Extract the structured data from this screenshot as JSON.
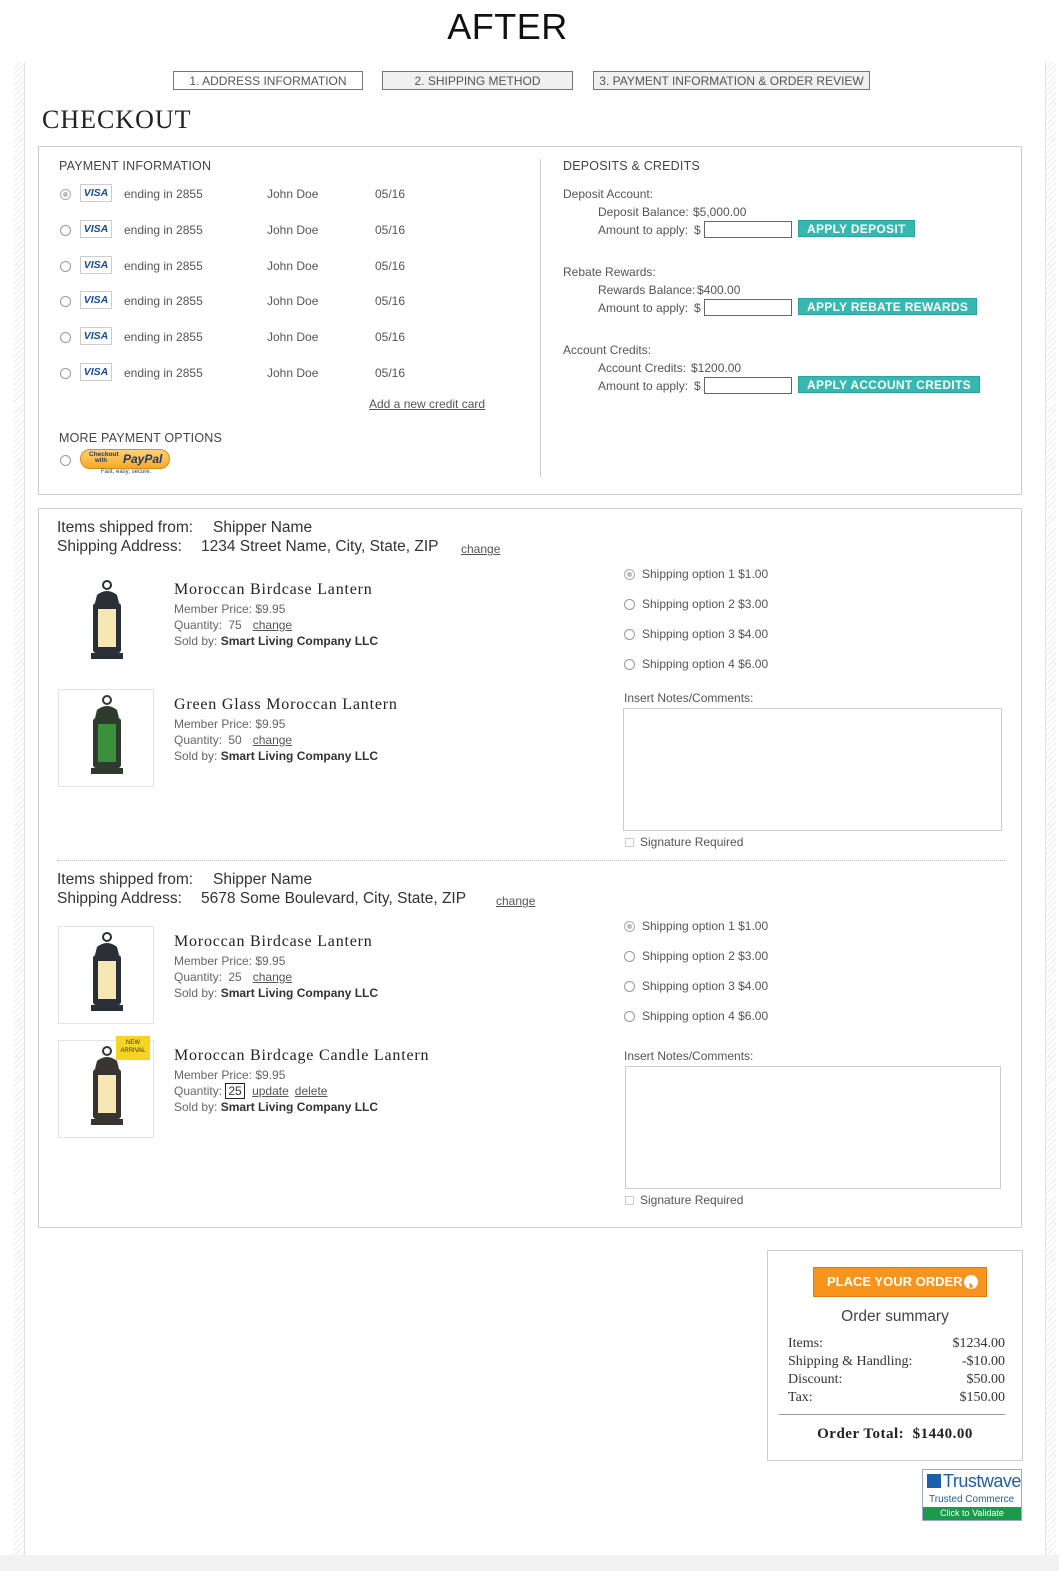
{
  "header": {
    "after_label": "AFTER"
  },
  "steps": [
    {
      "label": "1.  ADDRESS INFORMATION"
    },
    {
      "label": "2.  SHIPPING METHOD"
    },
    {
      "label": "3.  PAYMENT INFORMATION & ORDER REVIEW"
    }
  ],
  "page_title": "CHECKOUT",
  "payment": {
    "heading": "PAYMENT INFORMATION",
    "cards": [
      {
        "brand": "VISA",
        "ending": "ending in 2855",
        "name": "John Doe",
        "exp": "05/16",
        "selected": true
      },
      {
        "brand": "VISA",
        "ending": "ending in 2855",
        "name": "John Doe",
        "exp": "05/16",
        "selected": false
      },
      {
        "brand": "VISA",
        "ending": "ending in 2855",
        "name": "John Doe",
        "exp": "05/16",
        "selected": false
      },
      {
        "brand": "VISA",
        "ending": "ending in 2855",
        "name": "John Doe",
        "exp": "05/16",
        "selected": false
      },
      {
        "brand": "VISA",
        "ending": "ending in 2855",
        "name": "John Doe",
        "exp": "05/16",
        "selected": false
      },
      {
        "brand": "VISA",
        "ending": "ending in 2855",
        "name": "John Doe",
        "exp": "05/16",
        "selected": false
      }
    ],
    "add_card": "Add a new credit card",
    "more_heading": "MORE PAYMENT OPTIONS",
    "paypal": {
      "top": "Checkout",
      "with": "with",
      "brand": "PayPal",
      "tagline": "Fast, easy, secure."
    }
  },
  "deposits": {
    "heading": "DEPOSITS & CREDITS",
    "groups": [
      {
        "title": "Deposit Account:",
        "balance_label": "Deposit Balance:",
        "balance": "$5,000.00",
        "amount_label": "Amount to apply:",
        "currency": "$",
        "button": "APPLY DEPOSIT"
      },
      {
        "title": "Rebate Rewards:",
        "balance_label": "Rewards Balance:",
        "balance": "$400.00",
        "amount_label": "Amount to apply:",
        "currency": "$",
        "button": "APPLY REBATE REWARDS"
      },
      {
        "title": "Account Credits:",
        "balance_label": "Account Credits:",
        "balance": "$1200.00",
        "amount_label": "Amount to apply:",
        "currency": "$",
        "button": "APPLY ACCOUNT CREDITS"
      }
    ]
  },
  "shipments": [
    {
      "from_label": "Items shipped from:",
      "from": "Shipper Name",
      "addr_label": "Shipping Address:",
      "address": "1234 Street Name, City, State, ZIP",
      "change": "change",
      "items": [
        {
          "name": "Moroccan Birdcase Lantern",
          "price_label": "Member Price:",
          "price": "$9.95",
          "qty_label": "Quantity:",
          "qty": "75",
          "qty_action": "change",
          "sold_label": "Sold by:",
          "seller": "Smart Living Company LLC"
        },
        {
          "name": "Green Glass Moroccan Lantern",
          "price_label": "Member Price:",
          "price": "$9.95",
          "qty_label": "Quantity:",
          "qty": "50",
          "qty_action": "change",
          "sold_label": "Sold by:",
          "seller": "Smart Living Company LLC"
        }
      ],
      "options": [
        {
          "label": "Shipping option 1",
          "price": "$1.00",
          "selected": true
        },
        {
          "label": "Shipping option 2",
          "price": "$3.00",
          "selected": false
        },
        {
          "label": "Shipping option 3",
          "price": "$4.00",
          "selected": false
        },
        {
          "label": "Shipping option 4",
          "price": "$6.00",
          "selected": false
        }
      ],
      "notes_label": "Insert Notes/Comments:",
      "signature": "Signature Required"
    },
    {
      "from_label": "Items shipped from:",
      "from": "Shipper Name",
      "addr_label": "Shipping Address:",
      "address": "5678 Some Boulevard, City, State, ZIP",
      "change": "change",
      "items": [
        {
          "name": "Moroccan Birdcase Lantern",
          "price_label": "Member Price:",
          "price": "$9.95",
          "qty_label": "Quantity:",
          "qty": "25",
          "qty_action": "change",
          "sold_label": "Sold by:",
          "seller": "Smart Living Company LLC"
        },
        {
          "name": "Moroccan Birdcage Candle Lantern",
          "price_label": "Member Price:",
          "price": "$9.95",
          "qty_label": "Quantity:",
          "qty": "25",
          "update": "update",
          "delete": "delete",
          "sold_label": "Sold by:",
          "seller": "Smart Living Company LLC",
          "badge": [
            "NEW",
            "ARRIVAL"
          ]
        }
      ],
      "options": [
        {
          "label": "Shipping option 1",
          "price": "$1.00",
          "selected": true
        },
        {
          "label": "Shipping option 2",
          "price": "$3.00",
          "selected": false
        },
        {
          "label": "Shipping option 3",
          "price": "$4.00",
          "selected": false
        },
        {
          "label": "Shipping option 4",
          "price": "$6.00",
          "selected": false
        }
      ],
      "notes_label": "Insert Notes/Comments:",
      "signature": "Signature Required"
    }
  ],
  "summary": {
    "place_order": "PLACE YOUR ORDER",
    "title": "Order summary",
    "rows": [
      {
        "label": "Items:",
        "value": "$1234.00"
      },
      {
        "label": "Shipping & Handling:",
        "value": "-$10.00"
      },
      {
        "label": "Discount:",
        "value": "$50.00"
      },
      {
        "label": "Tax:",
        "value": "$150.00"
      }
    ],
    "total_label": "Order Total:",
    "total": "$1440.00"
  },
  "trustwave": {
    "brand": "Trustwave",
    "sub": "Trusted Commerce",
    "cta": "Click to Validate"
  },
  "colors": {
    "teal": "#35b8b0",
    "orange": "#f7941d",
    "visa_blue": "#1a4b9c",
    "paypal_gold": "#f9b43a",
    "trustwave_green": "#1a9a4a"
  }
}
